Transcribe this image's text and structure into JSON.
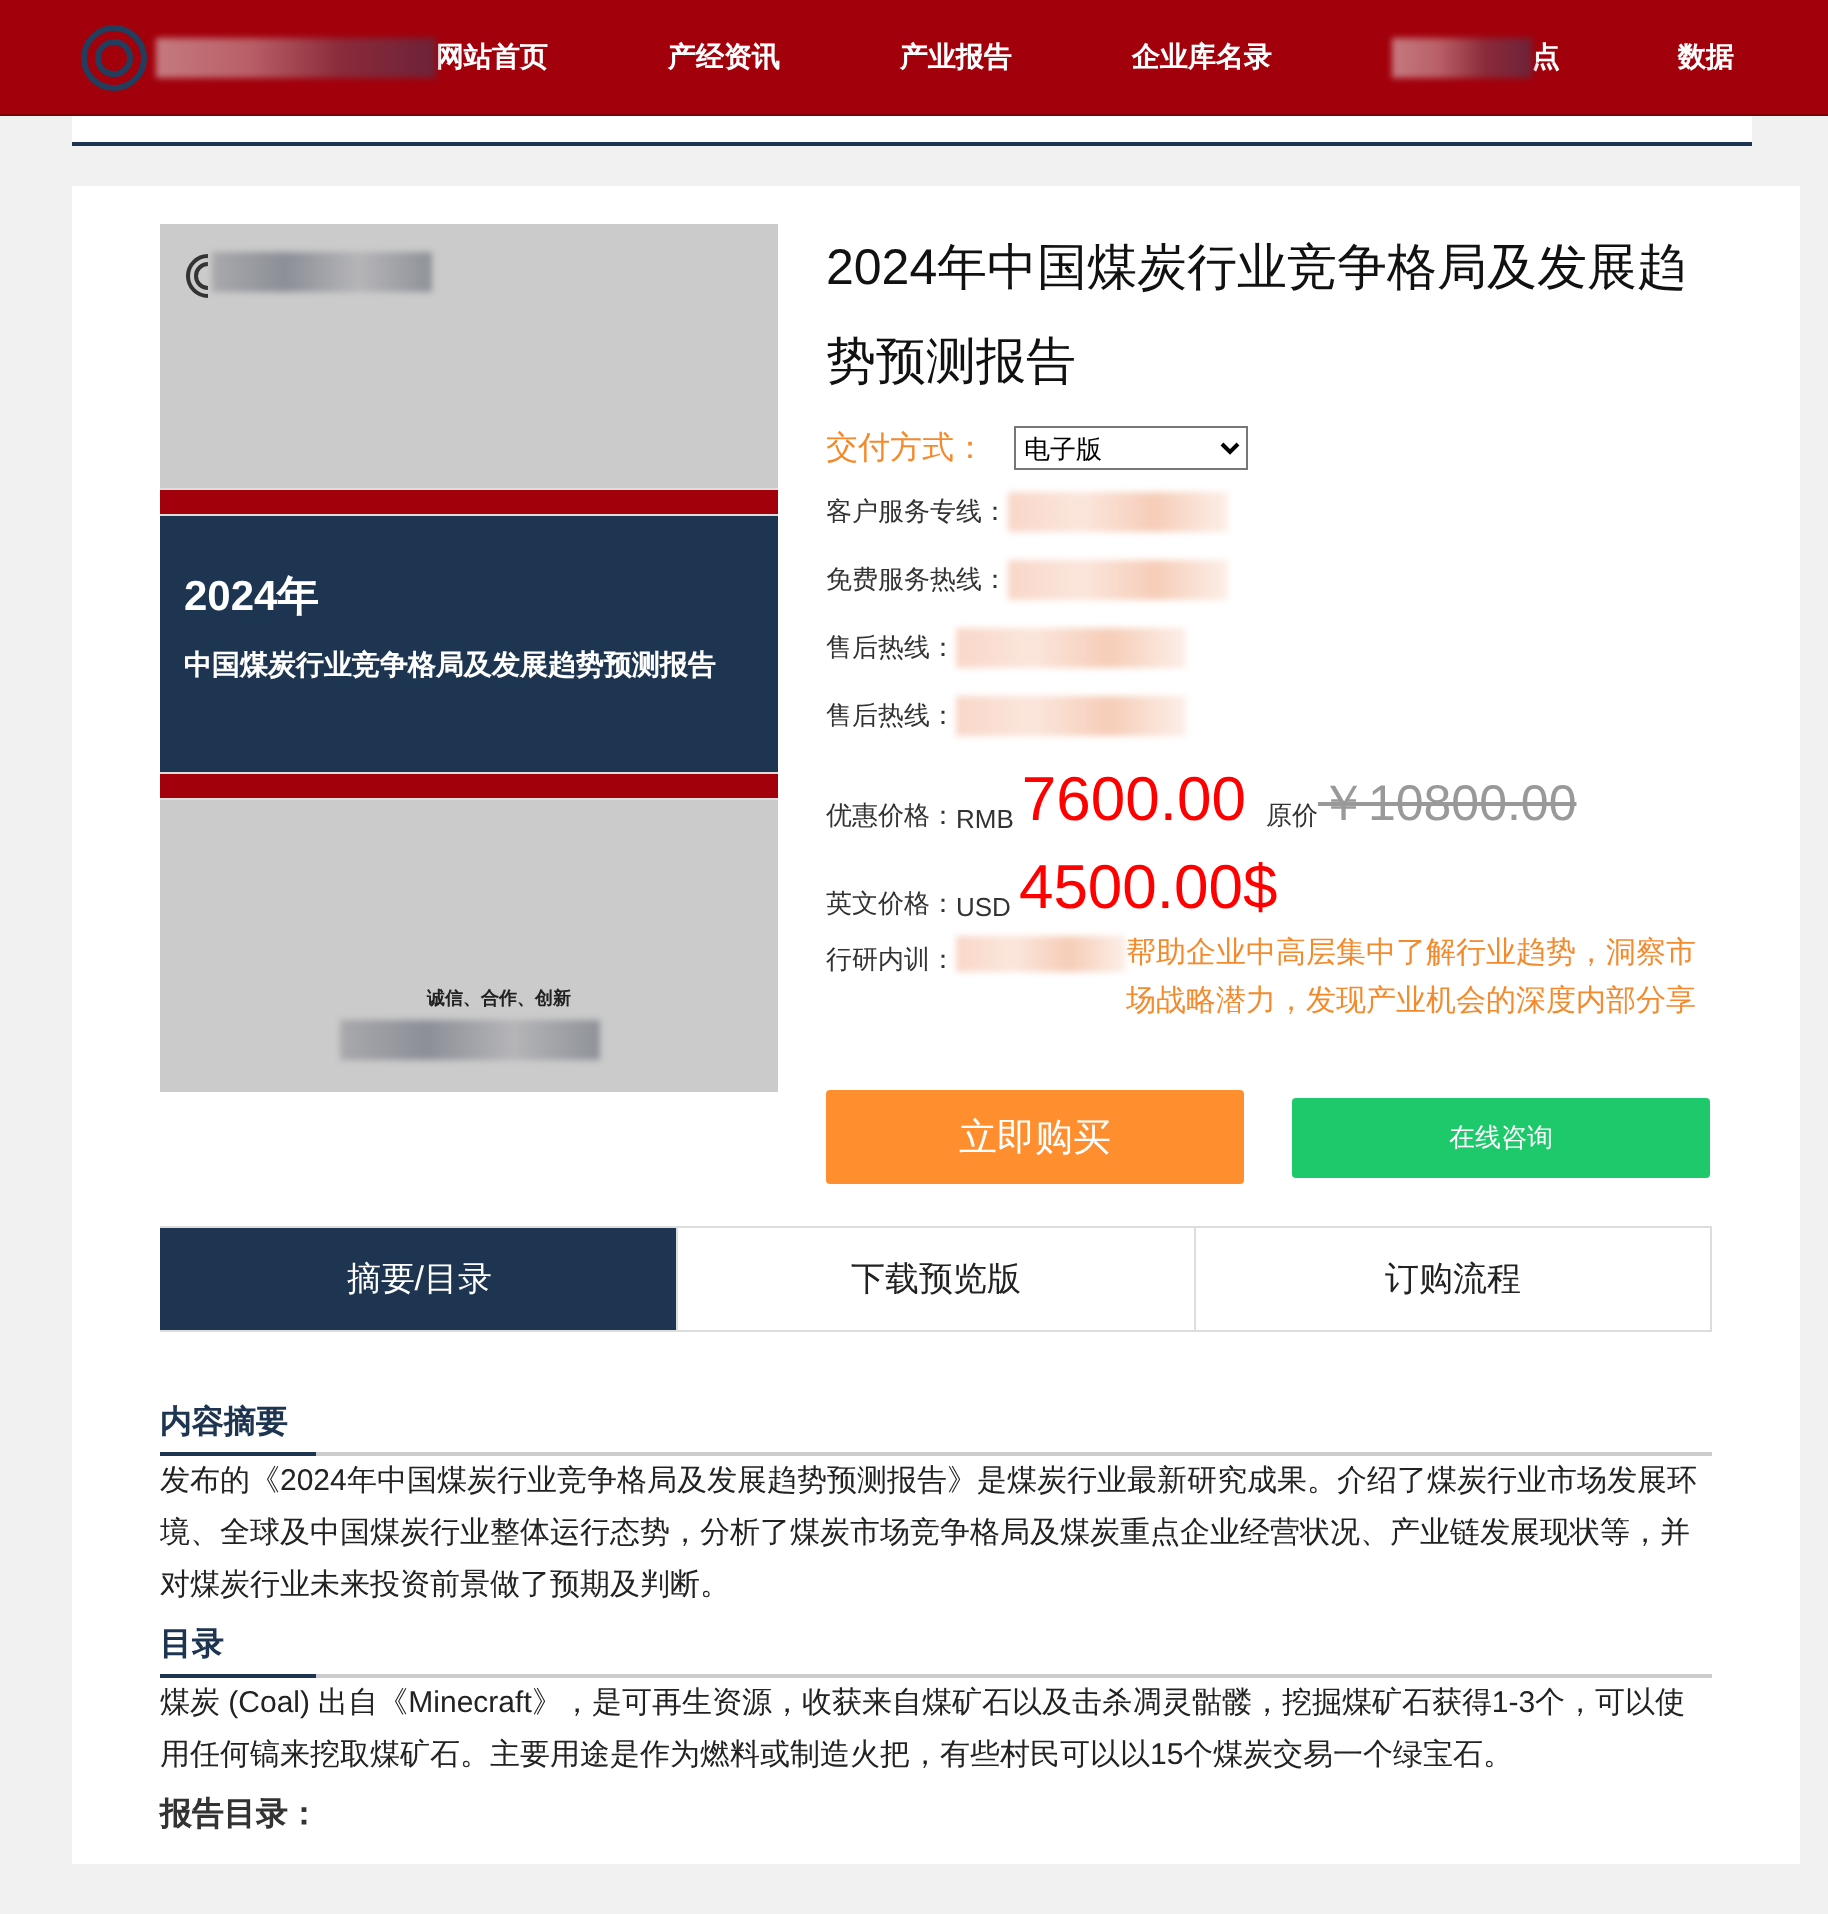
{
  "nav": {
    "items": [
      {
        "label": "网站首页"
      },
      {
        "label": "产经资讯"
      },
      {
        "label": "产业报告"
      },
      {
        "label": "企业库名录"
      },
      {
        "label": "点",
        "kind": "blurred"
      },
      {
        "label": "数据"
      }
    ]
  },
  "cover": {
    "year": "2024年",
    "title": "中国煤炭行业竞争格局及发展趋势预测报告",
    "slogan": "诚信、合作、创新"
  },
  "title": "2024年中国煤炭行业竞争格局及发展趋势预测报告",
  "delivery": {
    "label": "交付方式：",
    "value": "电子版"
  },
  "contacts": [
    {
      "label": "客户服务专线："
    },
    {
      "label": "免费服务热线："
    },
    {
      "label": "售后热线："
    },
    {
      "label": "售后热线："
    }
  ],
  "price": {
    "label": "优惠价格：",
    "currency": "RMB",
    "value": "7600.00",
    "original_label": "原价",
    "original_value": "￥10800.00"
  },
  "en_price": {
    "label": "英文价格：",
    "currency": "USD",
    "value": "4500.00$"
  },
  "training": {
    "label": "行研内训：",
    "text": "帮助企业中高层集中了解行业趋势，洞察市场战略潜力，发现产业机会的深度内部分享"
  },
  "buttons": [
    {
      "label": "立即购买",
      "kind": "buy"
    },
    {
      "label": "在线咨询",
      "kind": "consult"
    }
  ],
  "tabs": [
    {
      "label": "摘要/目录",
      "selected": true
    },
    {
      "label": "下载预览版",
      "selected": false
    },
    {
      "label": "订购流程",
      "selected": false
    }
  ],
  "sections": [
    {
      "heading": "内容摘要",
      "text": "发布的《2024年中国煤炭行业竞争格局及发展趋势预测报告》是煤炭行业最新研究成果。介绍了煤炭行业市场发展环境、全球及中国煤炭行业整体运行态势，分析了煤炭市场竞争格局及煤炭重点企业经营状况、产业链发展现状等，并对煤炭行业未来投资前景做了预期及判断。"
    },
    {
      "heading": "目录",
      "text": "煤炭 (Coal) 出自《Minecraft》，是可再生资源，收获来自煤矿石以及击杀凋灵骷髅，挖掘煤矿石获得1-3个，可以使用任何镐来挖取煤矿石。主要用途是作为燃料或制造火把，有些村民可以以15个煤炭交易一个绿宝石。"
    },
    {
      "heading": "报告目录：",
      "kind": "plain"
    }
  ]
}
